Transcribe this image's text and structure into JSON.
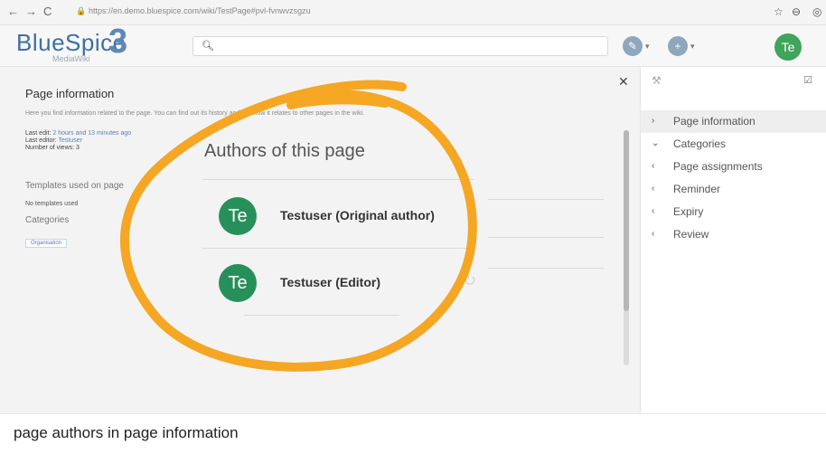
{
  "browser": {
    "url": "https://en.demo.bluespice.com/wiki/TestPage#pvl-fvnwvzsgzu",
    "back": "←",
    "forward": "→",
    "reload": "C",
    "lock": "🔒",
    "star": "☆"
  },
  "header": {
    "logo_text": "BlueSpice",
    "logo_number": "3",
    "logo_sub": "MediaWiki",
    "avatar": "Te"
  },
  "page_info": {
    "title": "Page information",
    "description": "Here you find information related to the page. You can find out its history and see how it relates to other pages in the wiki.",
    "last_edit_label": "Last edit:",
    "last_edit_value": "2 hours and 13 minutes ago",
    "last_editor_label": "Last editor:",
    "last_editor_value": "Testuser",
    "views": "Number of views: 3",
    "templates_title": "Templates used on page",
    "no_templates": "No templates used",
    "categories_title": "Categories",
    "category": "Organisation"
  },
  "dialog": {
    "title": "Authors of this page",
    "authors": [
      {
        "avatar": "Te",
        "name": "Testuser (Original author)"
      },
      {
        "avatar": "Te",
        "name": "Testuser (Editor)"
      }
    ]
  },
  "sidebar": {
    "items": [
      {
        "chevron": "›",
        "label": "Page information",
        "active": true
      },
      {
        "chevron": "⌄",
        "label": "Categories",
        "active": false
      },
      {
        "chevron": "‹",
        "label": "Page assignments",
        "active": false
      },
      {
        "chevron": "‹",
        "label": "Reminder",
        "active": false
      },
      {
        "chevron": "‹",
        "label": "Expiry",
        "active": false
      },
      {
        "chevron": "‹",
        "label": "Review",
        "active": false
      }
    ]
  },
  "caption": "page authors in page information",
  "colors": {
    "highlight": "#f5a623",
    "avatar_green": "#27905a",
    "link_blue": "#5b80b5"
  }
}
